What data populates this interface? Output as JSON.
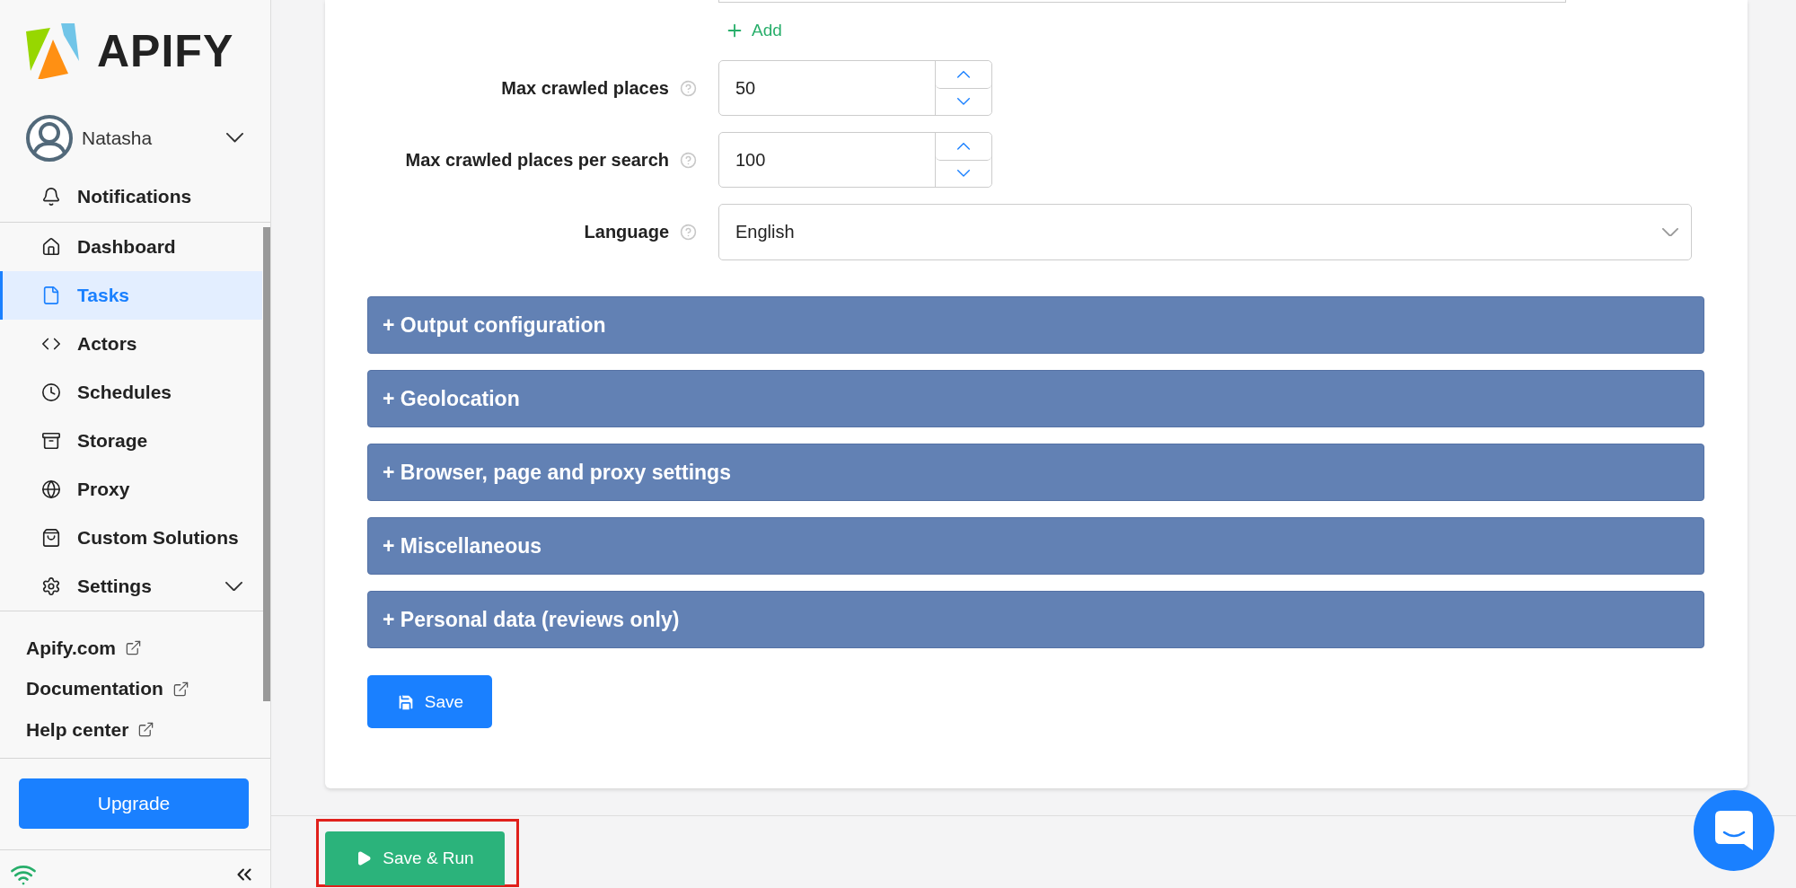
{
  "sidebar": {
    "logo": "APIFY",
    "user": {
      "name": "Natasha"
    },
    "notifications": "Notifications",
    "items": [
      {
        "label": "Dashboard",
        "selected": false,
        "expandable": false
      },
      {
        "label": "Tasks",
        "selected": true,
        "expandable": false
      },
      {
        "label": "Actors",
        "selected": false,
        "expandable": false
      },
      {
        "label": "Schedules",
        "selected": false,
        "expandable": false
      },
      {
        "label": "Storage",
        "selected": false,
        "expandable": false
      },
      {
        "label": "Proxy",
        "selected": false,
        "expandable": false
      },
      {
        "label": "Custom Solutions",
        "selected": false,
        "expandable": false
      },
      {
        "label": "Settings",
        "selected": false,
        "expandable": true
      }
    ],
    "links": [
      "Apify.com",
      "Documentation",
      "Help center"
    ],
    "upgrade": "Upgrade"
  },
  "form": {
    "add": "Add",
    "fields": [
      {
        "kind": "number",
        "label": "Max crawled places",
        "value": "50"
      },
      {
        "kind": "number",
        "label": "Max crawled places per search",
        "value": "100"
      },
      {
        "kind": "select",
        "label": "Language",
        "value": "English"
      }
    ],
    "sections": [
      "+ Output configuration",
      "+ Geolocation",
      "+ Browser, page and proxy settings",
      "+ Miscellaneous",
      "+ Personal data (reviews only)"
    ],
    "save": "Save"
  },
  "footer": {
    "save_run": "Save & Run",
    "highlighted": true
  }
}
